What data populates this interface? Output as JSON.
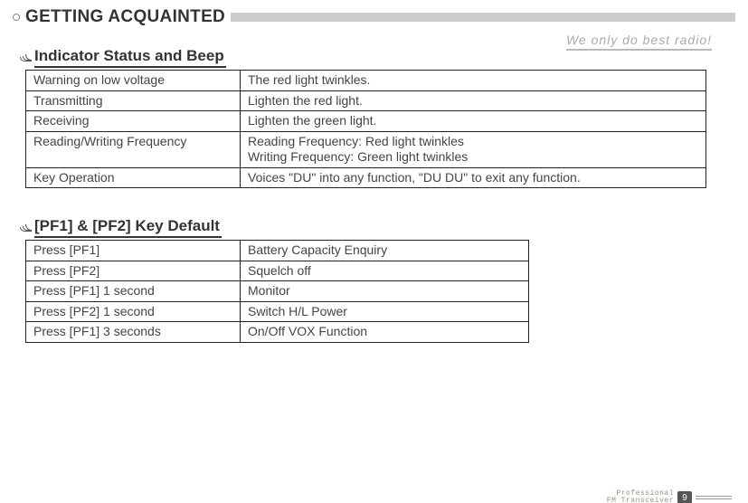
{
  "header": {
    "title": "GETTING ACQUAINTED",
    "tagline": "We only do best radio!"
  },
  "section1": {
    "title": "Indicator Status and Beep",
    "rows": [
      {
        "k": "Warning on low voltage",
        "v": "The red light twinkles."
      },
      {
        "k": "Transmitting",
        "v": "Lighten the red light."
      },
      {
        "k": "Receiving",
        "v": "Lighten the green light."
      },
      {
        "k": "Reading/Writing Frequency",
        "v": "Reading Frequency: Red light twinkles\nWriting Frequency: Green light twinkles"
      },
      {
        "k": "Key Operation",
        "v": "Voices \"DU\" into any function, \"DU DU\" to exit any function."
      }
    ]
  },
  "section2": {
    "title": "[PF1] & [PF2] Key Default",
    "rows": [
      {
        "k": "Press [PF1]",
        "v": "Battery Capacity Enquiry"
      },
      {
        "k": "Press [PF2]",
        "v": "Squelch off"
      },
      {
        "k": "Press [PF1] 1 second",
        "v": "Monitor"
      },
      {
        "k": "Press [PF2] 1 second",
        "v": "Switch H/L Power"
      },
      {
        "k": "Press [PF1] 3 seconds",
        "v": "On/Off VOX Function"
      }
    ]
  },
  "footer": {
    "line1": "Professional",
    "line2": "FM Transceiver",
    "page": "9"
  }
}
